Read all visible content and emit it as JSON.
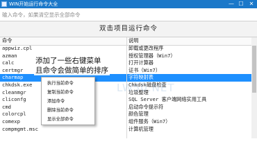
{
  "window": {
    "title": "WIN开始运行命令大全",
    "min_glyph": "—",
    "max_glyph": "☐",
    "close_glyph": "✕"
  },
  "search": {
    "placeholder": "输入命令，如果清空显示全部命令"
  },
  "section_title": "双击项目运行命令",
  "table": {
    "headers": {
      "command": "命令",
      "description": "说明"
    },
    "rows": [
      {
        "command": "appwiz.cpl",
        "description": "卸载或更改程序"
      },
      {
        "command": "azman",
        "description": "授权管理器（Win7）"
      },
      {
        "command": "calc",
        "description": "打开计算器"
      },
      {
        "command": "certmgr",
        "description": "证书（Win7）"
      },
      {
        "command": "charmap",
        "description": "字符映射表"
      },
      {
        "command": "chkdsk.exe",
        "description": "Chkdsk磁盘检查"
      },
      {
        "command": "cleanmgr",
        "description": "垃圾整理"
      },
      {
        "command": "cliconfg",
        "description": "SQL Server 客户端网络实用工具"
      },
      {
        "command": "cmd",
        "description": "启动命令提示符"
      },
      {
        "command": "colorcpl",
        "description": "颜色管理"
      },
      {
        "command": "comexp",
        "description": "组件服务（Win7）"
      },
      {
        "command": "compmgmt.msc",
        "description": "计算机管理"
      }
    ]
  },
  "annotation": {
    "line1": "添加了一些右键菜单",
    "line2": "且命令会做简单的排序"
  },
  "context_menu": {
    "items": [
      "执行当前命令",
      "复制当前命令",
      "添加命令",
      "删除当前命令",
      "显示全部命令"
    ]
  },
  "watermark": "LW50.NET",
  "colors": {
    "titlebar": "#1b78c9",
    "selection": "#1e90ff"
  }
}
